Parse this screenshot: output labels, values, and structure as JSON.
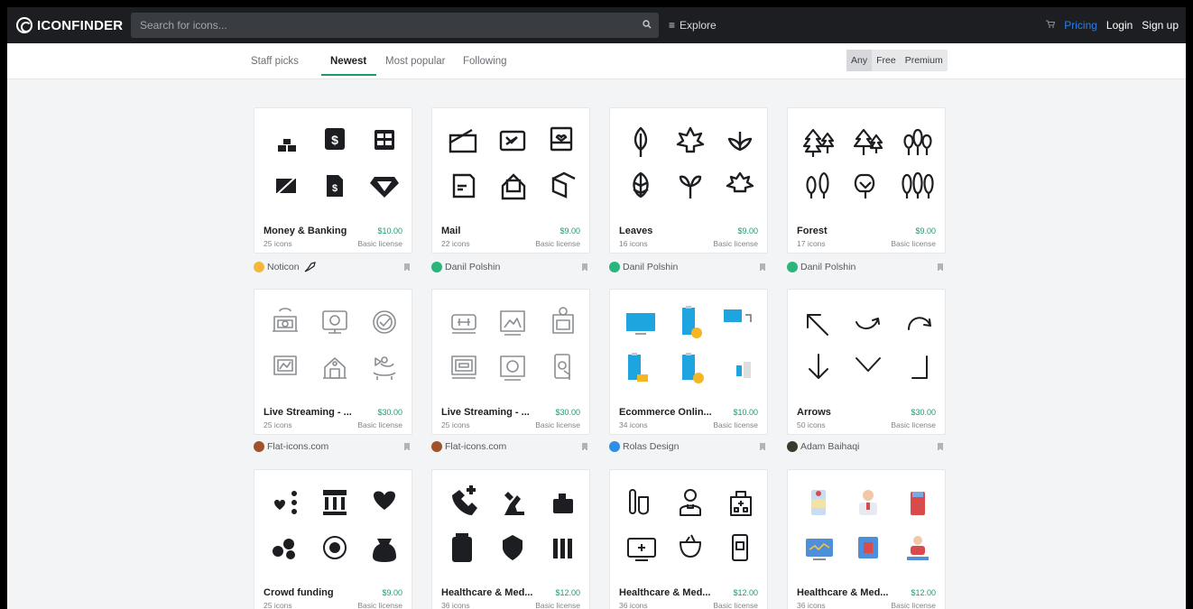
{
  "header": {
    "logo_text": "ICONFINDER",
    "search_placeholder": "Search for icons...",
    "explore_label": "Explore",
    "pricing_label": "Pricing",
    "login_label": "Login",
    "signup_label": "Sign up",
    "accent_color": "#2e7ee6"
  },
  "tabs": [
    {
      "label": "Staff picks",
      "active": false
    },
    {
      "label": "Newest",
      "active": true
    },
    {
      "label": "Most popular",
      "active": false
    },
    {
      "label": "Following",
      "active": false
    }
  ],
  "filter": {
    "options": [
      "Any",
      "Free",
      "Premium"
    ],
    "selected": "Any"
  },
  "cards": [
    {
      "title": "Money & Banking",
      "price": "$10.00",
      "count": "25 icons",
      "license": "Basic license",
      "author": "Noticon",
      "author_color": "#f4b93a"
    },
    {
      "title": "Mail",
      "price": "$9.00",
      "count": "22 icons",
      "license": "Basic license",
      "author": "Danil Polshin",
      "author_color": "#2bb57d"
    },
    {
      "title": "Leaves",
      "price": "$9.00",
      "count": "16 icons",
      "license": "Basic license",
      "author": "Danil Polshin",
      "author_color": "#2bb57d"
    },
    {
      "title": "Forest",
      "price": "$9.00",
      "count": "17 icons",
      "license": "Basic license",
      "author": "Danil Polshin",
      "author_color": "#2bb57d"
    },
    {
      "title": "Live Streaming - ...",
      "price": "$30.00",
      "count": "25 icons",
      "license": "Basic license",
      "author": "Flat-icons.com",
      "author_color": "#a0522d"
    },
    {
      "title": "Live Streaming - ...",
      "price": "$30.00",
      "count": "25 icons",
      "license": "Basic license",
      "author": "Flat-icons.com",
      "author_color": "#a0522d"
    },
    {
      "title": "Ecommerce Onlin...",
      "price": "$10.00",
      "count": "34 icons",
      "license": "Basic license",
      "author": "Rolas Design",
      "author_color": "#2e8ee6"
    },
    {
      "title": "Arrows",
      "price": "$30.00",
      "count": "50 icons",
      "license": "Basic license",
      "author": "Adam Baihaqi",
      "author_color": "#3a3a2a"
    },
    {
      "title": "Crowd funding",
      "price": "$9.00",
      "count": "25 icons",
      "license": "Basic license",
      "author": "",
      "author_color": ""
    },
    {
      "title": "Healthcare & Med...",
      "price": "$12.00",
      "count": "36 icons",
      "license": "Basic license",
      "author": "",
      "author_color": ""
    },
    {
      "title": "Healthcare & Med...",
      "price": "$12.00",
      "count": "36 icons",
      "license": "Basic license",
      "author": "",
      "author_color": ""
    },
    {
      "title": "Healthcare & Med...",
      "price": "$12.00",
      "count": "36 icons",
      "license": "Basic license",
      "author": "",
      "author_color": ""
    }
  ]
}
